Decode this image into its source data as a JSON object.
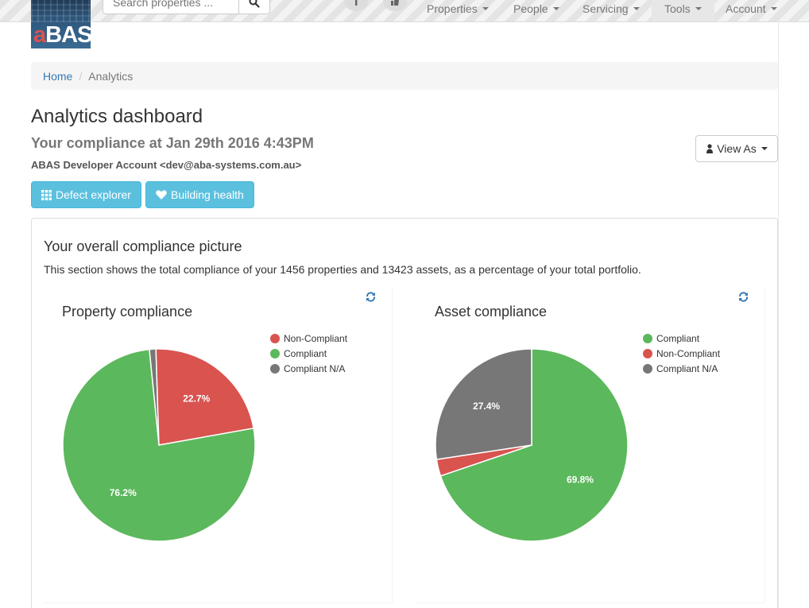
{
  "nav": {
    "logo_text_a": "a",
    "logo_text_rest": "BAS",
    "search_placeholder": "Search properties ...",
    "menus": [
      {
        "label": "Properties"
      },
      {
        "label": "People"
      },
      {
        "label": "Servicing"
      },
      {
        "label": "Tools"
      },
      {
        "label": "Account"
      }
    ]
  },
  "breadcrumb": {
    "home": "Home",
    "separator": "/",
    "current": "Analytics"
  },
  "page": {
    "title": "Analytics dashboard",
    "subtitle": "Your compliance at Jan 29th 2016 4:43PM",
    "account": "ABAS Developer Account <dev@aba-systems.com.au>",
    "view_as": "View As"
  },
  "buttons": {
    "defect_explorer": "Defect explorer",
    "building_health": "Building health"
  },
  "panel": {
    "title": "Your overall compliance picture",
    "description": "This section shows the total compliance of your 1456 properties and 13423 assets, as a percentage of your total portfolio."
  },
  "colors": {
    "non_compliant": "#d9534f",
    "compliant": "#5cb85c",
    "na": "#777777",
    "link": "#337ab7",
    "info": "#5bc0de"
  },
  "chart_data": [
    {
      "type": "pie",
      "title": "Property compliance",
      "legend_position": "top-right",
      "slices": [
        {
          "name": "Non-Compliant",
          "value": 22.7,
          "color": "#d9534f",
          "label": "22.7%"
        },
        {
          "name": "Compliant",
          "value": 76.2,
          "color": "#5cb85c",
          "label": "76.2%"
        },
        {
          "name": "Compliant N/A",
          "value": 1.1,
          "color": "#777777",
          "label": ""
        }
      ]
    },
    {
      "type": "pie",
      "title": "Asset compliance",
      "legend_position": "top-right",
      "slices": [
        {
          "name": "Compliant",
          "value": 69.8,
          "color": "#5cb85c",
          "label": "69.8%"
        },
        {
          "name": "Non-Compliant",
          "value": 2.8,
          "color": "#d9534f",
          "label": ""
        },
        {
          "name": "Compliant N/A",
          "value": 27.4,
          "color": "#777777",
          "label": "27.4%"
        }
      ]
    }
  ]
}
